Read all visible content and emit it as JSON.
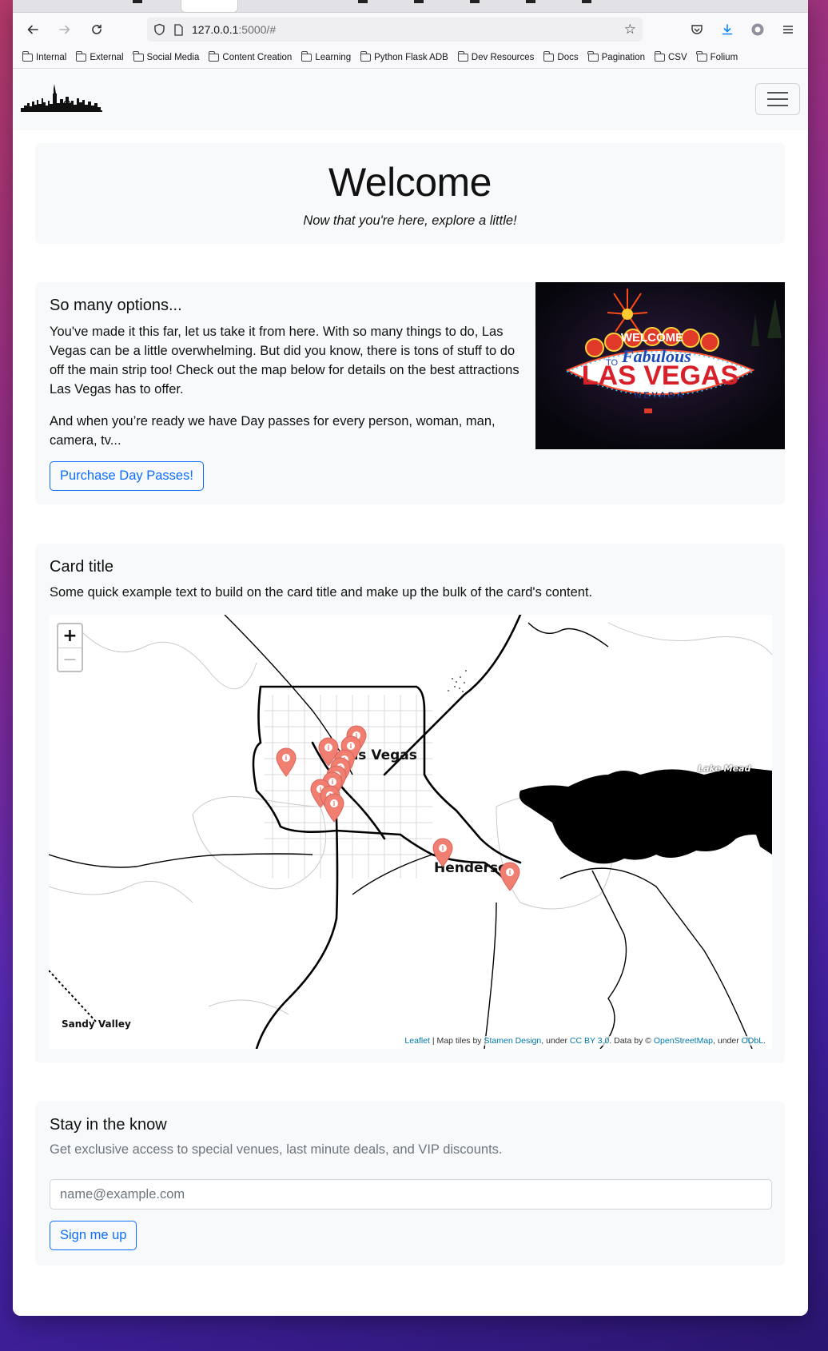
{
  "browser": {
    "url_host": "127.0.0.1",
    "url_path": ":5000/#",
    "bookmarks": [
      "Internal",
      "External",
      "Social Media",
      "Content Creation",
      "Learning",
      "Python Flask ADB",
      "Dev Resources",
      "Docs",
      "Pagination",
      "CSV",
      "Folium"
    ]
  },
  "hero": {
    "title": "Welcome",
    "subtitle": "Now that you're here, explore a little!"
  },
  "options": {
    "title": "So many options...",
    "paragraph1": "You've made it this far, let us take it from here. With so many things to do, Las Vegas can be a little overwhelming. But did you know, there is tons of stuff to do off the main strip too! Check out the map below for details on the best attractions Las Vegas has to offer.",
    "paragraph2": "And when you’re ready we have Day passes for every person, woman, man, camera, tv...",
    "button": "Purchase Day Passes!",
    "sign": {
      "welcome": "WELCOME",
      "to": "TO",
      "fabulous": "Fabulous",
      "las_vegas": "LAS VEGAS",
      "nevada": "NEVADA"
    }
  },
  "map_card": {
    "title": "Card title",
    "text": "Some quick example text to build on the card title and make up the bulk of the card's content.",
    "zoom_in": "+",
    "zoom_out": "−",
    "labels": {
      "las_vegas": "Las Vegas",
      "henderson": "Henderson",
      "lake_mead": "Lake Mead",
      "sandy_valley": "Sandy Valley"
    },
    "attribution": {
      "leaflet": "Leaflet",
      "sep1": " | Map tiles by ",
      "stamen": "Stamen Design",
      "sep2": ", under ",
      "ccby": "CC BY 3.0",
      "sep3": ". Data by © ",
      "osm": "OpenStreetMap",
      "sep4": ", under ",
      "odbl": "ODbL",
      "end": "."
    },
    "marker_color": "#f07f72"
  },
  "newsletter": {
    "title": "Stay in the know",
    "text": "Get exclusive access to special venues, last minute deals, and VIP discounts.",
    "email_placeholder": "name@example.com",
    "button": "Sign me up"
  }
}
